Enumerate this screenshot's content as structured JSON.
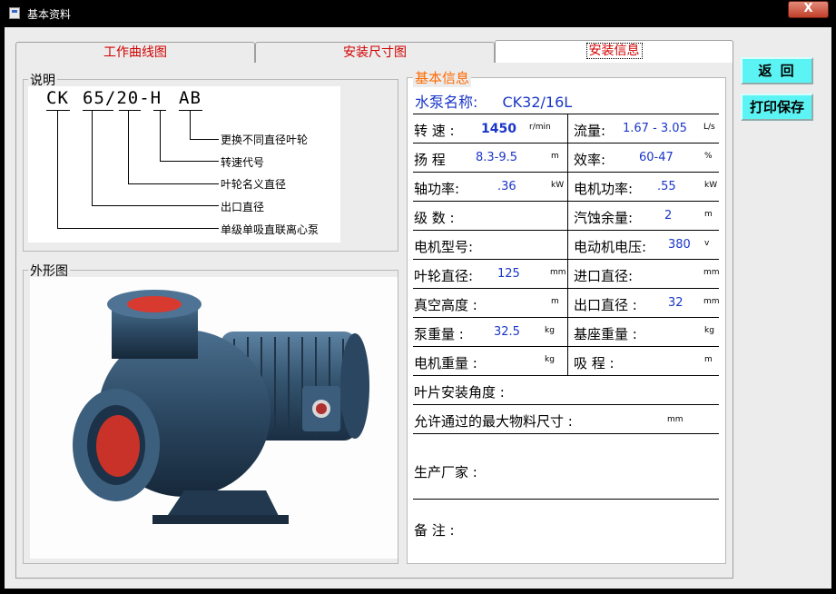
{
  "window": {
    "title": "基本资料",
    "close_label": "X"
  },
  "tabs": [
    {
      "label": "工作曲线图"
    },
    {
      "label": "安装尺寸图"
    },
    {
      "label": "安装信息"
    }
  ],
  "explain": {
    "title": "说明",
    "code_parts": [
      "CK",
      "65/20-H",
      "AB"
    ],
    "labels": [
      "更换不同直径叶轮",
      "转速代号",
      "叶轮名义直径",
      "出口直径",
      "单级单吸直联离心泵"
    ]
  },
  "appearance": {
    "title": "外形图"
  },
  "info": {
    "title": "基本信息",
    "pump_name_label": "水泵名称:",
    "pump_name": "CK32/16L",
    "rows": [
      {
        "l_label": "转 速 :",
        "l_value": "1450",
        "l_unit": "r/min",
        "r_label": "流量:",
        "r_value": "1.67 - 3.05",
        "r_unit": "L/s"
      },
      {
        "l_label": "扬 程",
        "l_value": "8.3-9.5",
        "l_unit": "m",
        "r_label": "效率:",
        "r_value": "60-47",
        "r_unit": "%"
      },
      {
        "l_label": "轴功率:",
        "l_value": ".36",
        "l_unit": "kW",
        "r_label": "电机功率:",
        "r_value": ".55",
        "r_unit": "kW"
      },
      {
        "l_label": "级 数 :",
        "l_value": "",
        "l_unit": "",
        "r_label": "汽蚀余量:",
        "r_value": "2",
        "r_unit": "m"
      },
      {
        "l_label": "电机型号:",
        "l_value": "",
        "l_unit": "",
        "r_label": "电动机电压:",
        "r_value": "380",
        "r_unit": "v"
      },
      {
        "l_label": "叶轮直径:",
        "l_value": "125",
        "l_unit": "mm",
        "r_label": "进口直径:",
        "r_value": "",
        "r_unit": "mm"
      },
      {
        "l_label": "真空高度 :",
        "l_value": "",
        "l_unit": "m",
        "r_label": "出口直径 :",
        "r_value": "32",
        "r_unit": "mm"
      },
      {
        "l_label": "泵重量 :",
        "l_value": "32.5",
        "l_unit": "kg",
        "r_label": "基座重量 :",
        "r_value": "",
        "r_unit": "kg"
      },
      {
        "l_label": "电机重量 :",
        "l_value": "",
        "l_unit": "kg",
        "r_label": "吸 程 :",
        "r_value": "",
        "r_unit": "m"
      }
    ],
    "blade_angle_label": "叶片安装角度 :",
    "max_material_label": "允许通过的最大物料尺寸 :",
    "max_material_unit": "mm",
    "manufacturer_label": "生产厂家 :",
    "remark_label": "备 注 :"
  },
  "buttons": {
    "back": "返 回",
    "print_save": "打印保存"
  },
  "colors": {
    "tab_text": "#d00000",
    "value_blue": "#1a36c8",
    "info_title": "#ff6a00",
    "button_bg": "#5bf3f3"
  }
}
